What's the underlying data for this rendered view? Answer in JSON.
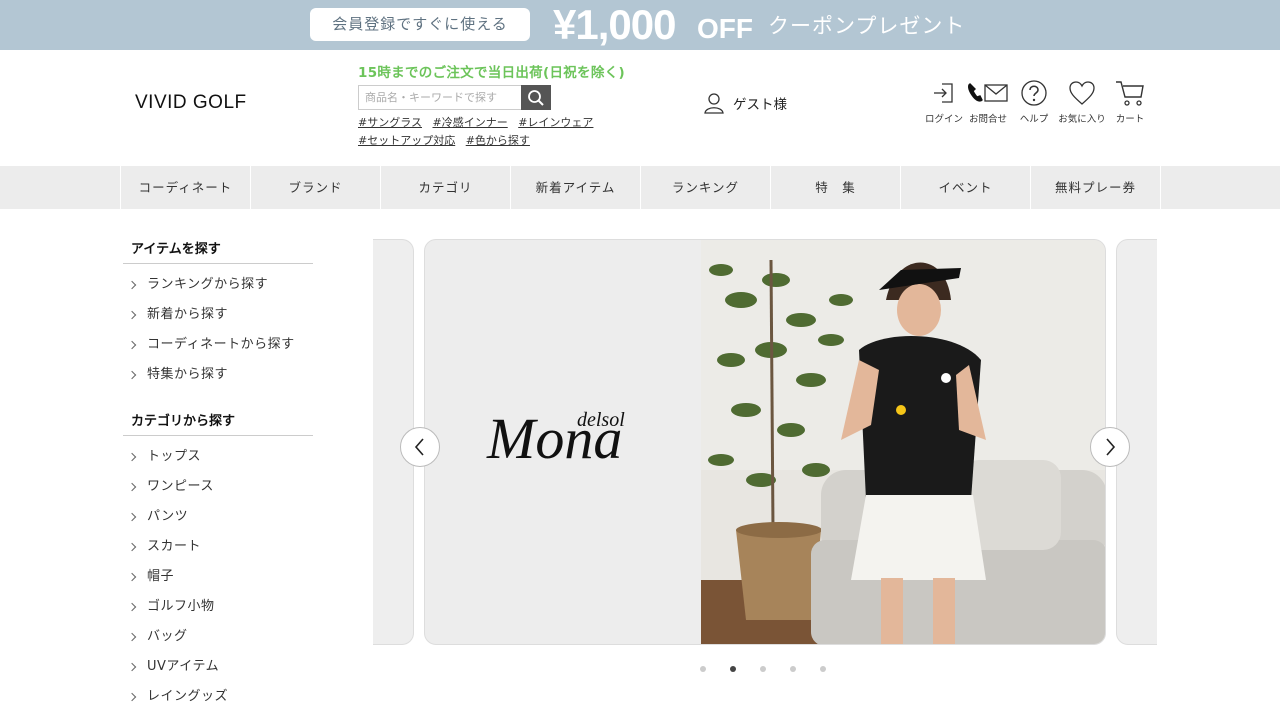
{
  "promo": {
    "pill_text": "会員登録ですぐに使える",
    "amount": "¥1,000",
    "off": "OFF",
    "rest": "クーポンプレゼント"
  },
  "header": {
    "logo": "VIVID GOLF",
    "shipping": "15時までのご注文で当日出荷(日祝を除く)",
    "search_placeholder": "商品名・キーワードで探す",
    "tags": [
      "#サングラス",
      "#冷感インナー",
      "#レインウェア",
      "#セットアップ対応",
      "#色から探す"
    ],
    "guest": "ゲスト様",
    "icons": [
      {
        "icon": "login-icon",
        "label": "ログイン"
      },
      {
        "icon": "contact-icon",
        "label": "お問合せ"
      },
      {
        "icon": "help-icon",
        "label": "ヘルプ"
      },
      {
        "icon": "heart-icon",
        "label": "お気に入り"
      },
      {
        "icon": "cart-icon",
        "label": "カート"
      }
    ]
  },
  "nav": [
    "コーディネート",
    "ブランド",
    "カテゴリ",
    "新着アイテム",
    "ランキング",
    "特　集",
    "イベント",
    "無料プレー券"
  ],
  "sidebar": {
    "heading1": "アイテムを探す",
    "items1": [
      "ランキングから探す",
      "新着から探す",
      "コーディネートから探す",
      "特集から探す"
    ],
    "heading2": "カテゴリから探す",
    "items2": [
      "トップス",
      "ワンピース",
      "パンツ",
      "スカート",
      "帽子",
      "ゴルフ小物",
      "バッグ",
      "UVアイテム",
      "レイングッズ"
    ]
  },
  "carousel": {
    "brand_main": "Mona",
    "brand_sub": "delsol",
    "slide_count": 5,
    "active_index": 1
  },
  "colors": {
    "promo_bg": "#b3c6d3",
    "shipping_green": "#6cc45a",
    "nav_bg": "#ececec"
  }
}
